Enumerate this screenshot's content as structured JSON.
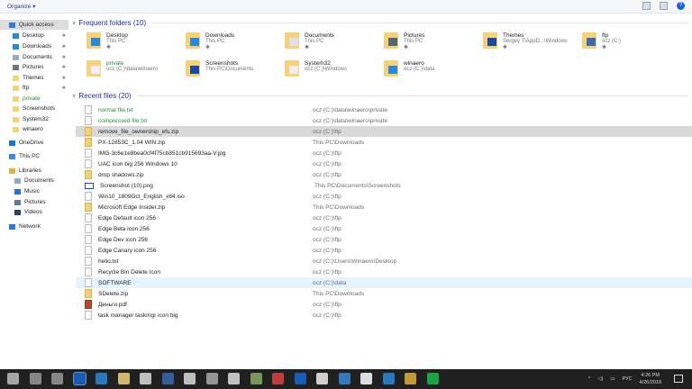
{
  "toolbar": {
    "organize": "Organize ▾"
  },
  "sidebar": [
    {
      "label": "Quick access",
      "top": true,
      "sel": true,
      "color": "#3a7bd5"
    },
    {
      "label": "Desktop",
      "pin": true,
      "color": "#2b88d8"
    },
    {
      "label": "Downloads",
      "pin": true,
      "color": "#2b88d8"
    },
    {
      "label": "Documents",
      "pin": true,
      "color": "#9ab"
    },
    {
      "label": "Pictures",
      "pin": true,
      "color": "#678"
    },
    {
      "label": "Themes",
      "pin": true,
      "color": "#f3d27b"
    },
    {
      "label": "ftp",
      "pin": true,
      "color": "#f3d27b"
    },
    {
      "label": "private",
      "green": true,
      "color": "#f3d27b"
    },
    {
      "label": "Screenshots",
      "color": "#f3d27b"
    },
    {
      "label": "System32",
      "color": "#f3d27b"
    },
    {
      "label": "winaero",
      "color": "#f3d27b"
    },
    {
      "label": "OneDrive",
      "top": true,
      "color": "#1a73d8"
    },
    {
      "label": "This PC",
      "top": true,
      "color": "#3a8ad8"
    },
    {
      "label": "Libraries",
      "top": true,
      "color": "#e0b040"
    },
    {
      "label": "Documents",
      "sub": true,
      "color": "#9ab"
    },
    {
      "label": "Music",
      "sub": true,
      "color": "#2b6ed8"
    },
    {
      "label": "Pictures",
      "sub": true,
      "color": "#678"
    },
    {
      "label": "Videos",
      "sub": true,
      "color": "#345"
    },
    {
      "label": "Network",
      "top": true,
      "color": "#2b78d8"
    }
  ],
  "frequent": {
    "title": "Frequent folders (10)",
    "items": [
      {
        "name": "Desktop",
        "sub": "This PC",
        "pinned": true,
        "overlay": "#2b88d8"
      },
      {
        "name": "Downloads",
        "sub": "This PC",
        "pinned": true,
        "overlay": "#2b88d8"
      },
      {
        "name": "Documents",
        "sub": "This PC",
        "pinned": true,
        "overlay": "#dde"
      },
      {
        "name": "Pictures",
        "sub": "This PC",
        "pinned": true,
        "overlay": "#567"
      },
      {
        "name": "Themes",
        "sub": "Sergey T\\AppD...\\Windows",
        "pinned": true,
        "overlay": "#1a4aa0"
      },
      {
        "name": "ftp",
        "sub": "ocz (C:)",
        "pinned": true,
        "overlay": "#3a6ab0"
      },
      {
        "name": "private",
        "sub": "ocz (C:)\\data\\winaero",
        "green": true,
        "overlay": "#eef"
      },
      {
        "name": "Screenshots",
        "sub": "This PC\\Documents",
        "overlay": "#1a4aa0"
      },
      {
        "name": "System32",
        "sub": "ocz (C:)\\Windows",
        "overlay": "#eee"
      },
      {
        "name": "winaero",
        "sub": "ocz (C:)\\data",
        "overlay": "#2b88d8"
      }
    ]
  },
  "recent": {
    "title": "Recent files (20)",
    "items": [
      {
        "name": "normal file.txt",
        "path": "ocz (C:)\\data\\winaero\\private",
        "green": true,
        "type": "txt"
      },
      {
        "name": "compressed file.txt",
        "path": "ocz (C:)\\data\\winaero\\private",
        "green": true,
        "type": "txt"
      },
      {
        "name": "remove_file_ownership_efs.zip",
        "path": "ocz (C:)\\ftp",
        "type": "zip",
        "state": "sel"
      },
      {
        "name": "PX-12853C_1.04 WIN.zip",
        "path": "This PC\\Downloads",
        "type": "zip"
      },
      {
        "name": "IMG-3c6e1e8bea0cf4f75cb851cb915693aa-V.jpg",
        "path": "ocz (C:)\\ftp",
        "type": "file"
      },
      {
        "name": "UAC icon big 256 Windows 10",
        "path": "ocz (C:)\\ftp",
        "type": "file"
      },
      {
        "name": "drop shadows.zip",
        "path": "ocz (C:)\\ftp",
        "type": "zip"
      },
      {
        "name": "Screenshot (10).png",
        "path": "This PC\\Documents\\Screenshots",
        "type": "png"
      },
      {
        "name": "Win10_1809Oct_English_x64.iso",
        "path": "ocz (C:)\\ftp",
        "type": "file"
      },
      {
        "name": "Microsoft Edge Insider.zip",
        "path": "This PC\\Downloads",
        "type": "zip"
      },
      {
        "name": "Edge Default icon 256",
        "path": "ocz (C:)\\ftp",
        "type": "file"
      },
      {
        "name": "Edge Beta icon 256",
        "path": "ocz (C:)\\ftp",
        "type": "file"
      },
      {
        "name": "Edge Dev icon 256",
        "path": "ocz (C:)\\ftp",
        "type": "file"
      },
      {
        "name": "Edge Canary icon 256",
        "path": "ocz (C:)\\ftp",
        "type": "file"
      },
      {
        "name": "hello.txt",
        "path": "ocz (C:)\\Users\\Winaero\\Desktop",
        "type": "txt"
      },
      {
        "name": "Recycle Bin Delete Icon",
        "path": "ocz (C:)\\ftp",
        "type": "file"
      },
      {
        "name": "SOFTWARE",
        "path": "ocz (C:)\\data",
        "type": "file",
        "state": "hov"
      },
      {
        "name": "SDelete.zip",
        "path": "This PC\\Downloads",
        "type": "zip"
      },
      {
        "name": "Деньги.pdf",
        "path": "ocz (C:)\\ftp",
        "type": "pdf"
      },
      {
        "name": "task manager taskmgr icon big",
        "path": "ocz (C:)\\ftp",
        "type": "file"
      }
    ]
  },
  "taskbar": {
    "icons": [
      "windows-start",
      "search",
      "task-view",
      "winaero-tweaker",
      "edge",
      "explorer",
      "store",
      "save",
      "settings",
      "app",
      "app",
      "app",
      "app",
      "app",
      "app",
      "app",
      "app",
      "app",
      "app",
      "spotify"
    ],
    "tray": {
      "lang": "РУС",
      "time": "4:26 PM",
      "date": "4/26/2019"
    }
  },
  "colors": {
    "accent": "#1e3287",
    "taskbar": "#202020",
    "selected": "#d9d9d9",
    "hover": "#e5f3ff"
  }
}
